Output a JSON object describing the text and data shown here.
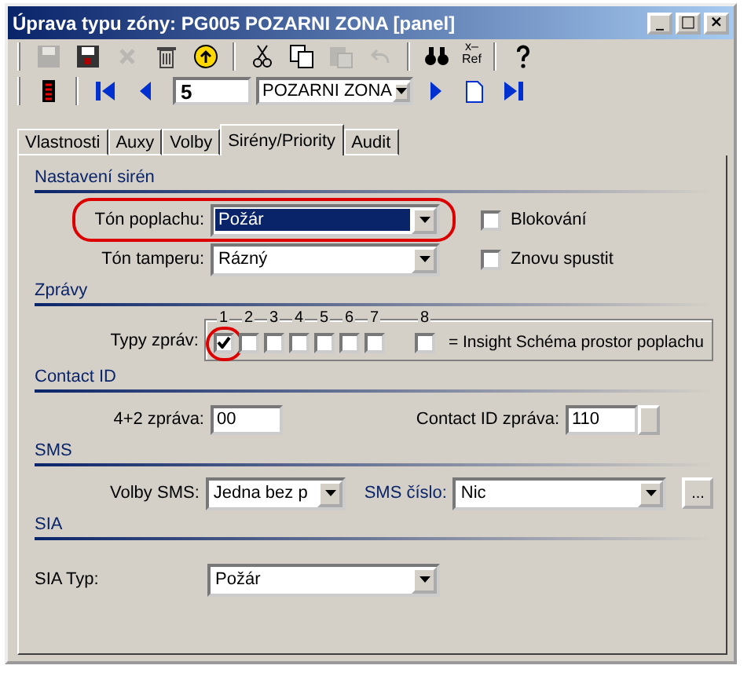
{
  "window": {
    "title": "Úprava typu zóny: PG005 POZARNI ZONA [panel]",
    "controls": [
      "_",
      "□",
      "×"
    ]
  },
  "toolbar_1": [
    {
      "kind": "save",
      "disabled": true
    },
    {
      "kind": "save-as",
      "disabled": false
    },
    {
      "kind": "cancel",
      "disabled": true
    },
    {
      "kind": "trash",
      "disabled": false
    },
    {
      "kind": "up",
      "disabled": false
    },
    {
      "kind": "sep"
    },
    {
      "kind": "cut",
      "disabled": false
    },
    {
      "kind": "copy",
      "disabled": false
    },
    {
      "kind": "paste",
      "disabled": true
    },
    {
      "kind": "undo",
      "disabled": true
    },
    {
      "kind": "sep"
    },
    {
      "kind": "find",
      "disabled": false
    },
    {
      "kind": "xref",
      "lines": [
        "x–",
        "Ref"
      ],
      "disabled": false
    },
    {
      "kind": "sep"
    },
    {
      "kind": "help",
      "disabled": false
    }
  ],
  "toolbar_2": {
    "record_number": "5",
    "record_name": "POZARNI ZONA"
  },
  "tabs": [
    {
      "label": "Vlastnosti",
      "selected": false
    },
    {
      "label": "Auxy",
      "selected": false
    },
    {
      "label": "Volby",
      "selected": false
    },
    {
      "label": "Sirény/Priority",
      "selected": true
    },
    {
      "label": "Audit",
      "selected": false
    }
  ],
  "sirens": {
    "heading": "Nastavení sirén",
    "alarm_tone": {
      "label": "Tón poplachu:",
      "value": "Požár",
      "focused": true,
      "highlighted": true
    },
    "tamper_tone": {
      "label": "Tón tamperu:",
      "value": "Rázný"
    },
    "blocking": {
      "label": "Blokování",
      "checked": false
    },
    "restart": {
      "label": "Znovu spustit",
      "checked": false
    }
  },
  "messages": {
    "heading": "Zprávy",
    "label": "Typy zpráv:",
    "types": [
      {
        "label": "1",
        "checked": true,
        "highlighted": true
      },
      {
        "label": "2",
        "checked": false,
        "highlighted": false
      },
      {
        "label": "3",
        "checked": false,
        "highlighted": false
      },
      {
        "label": "4",
        "checked": false,
        "highlighted": false
      },
      {
        "label": "5",
        "checked": false,
        "highlighted": false
      },
      {
        "label": "6",
        "checked": false,
        "highlighted": false
      },
      {
        "label": "7",
        "checked": false,
        "highlighted": false
      },
      {
        "label": "8",
        "checked": false,
        "highlighted": false
      }
    ],
    "legend": "= Insight Schéma prostor poplachu"
  },
  "contact_id": {
    "heading": "Contact ID",
    "four_two_label": "4+2 zpráva:",
    "four_two_value": "00",
    "cid_label": "Contact ID zpráva:",
    "cid_value": "110"
  },
  "sms": {
    "heading": "SMS",
    "options_label": "Volby SMS:",
    "options_value": "Jedna bez p",
    "number_label": "SMS číslo:",
    "number_value": "Nic",
    "browse": "..."
  },
  "sia": {
    "heading": "SIA",
    "type_label": "SIA Typ:",
    "type_value": "Požár"
  }
}
